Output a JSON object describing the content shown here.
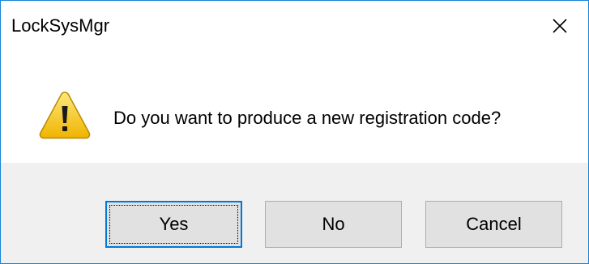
{
  "window": {
    "title": "LockSysMgr"
  },
  "dialog": {
    "icon": "warning-icon",
    "message": "Do you want to produce a new registration code?"
  },
  "buttons": {
    "yes_label": "Yes",
    "no_label": "No",
    "cancel_label": "Cancel"
  },
  "colors": {
    "border_accent": "#1883d7",
    "default_button_border": "#0078d7",
    "footer_background": "#f0f0f0",
    "button_face": "#e1e1e1",
    "warning_yellow": "#f5c21b"
  }
}
